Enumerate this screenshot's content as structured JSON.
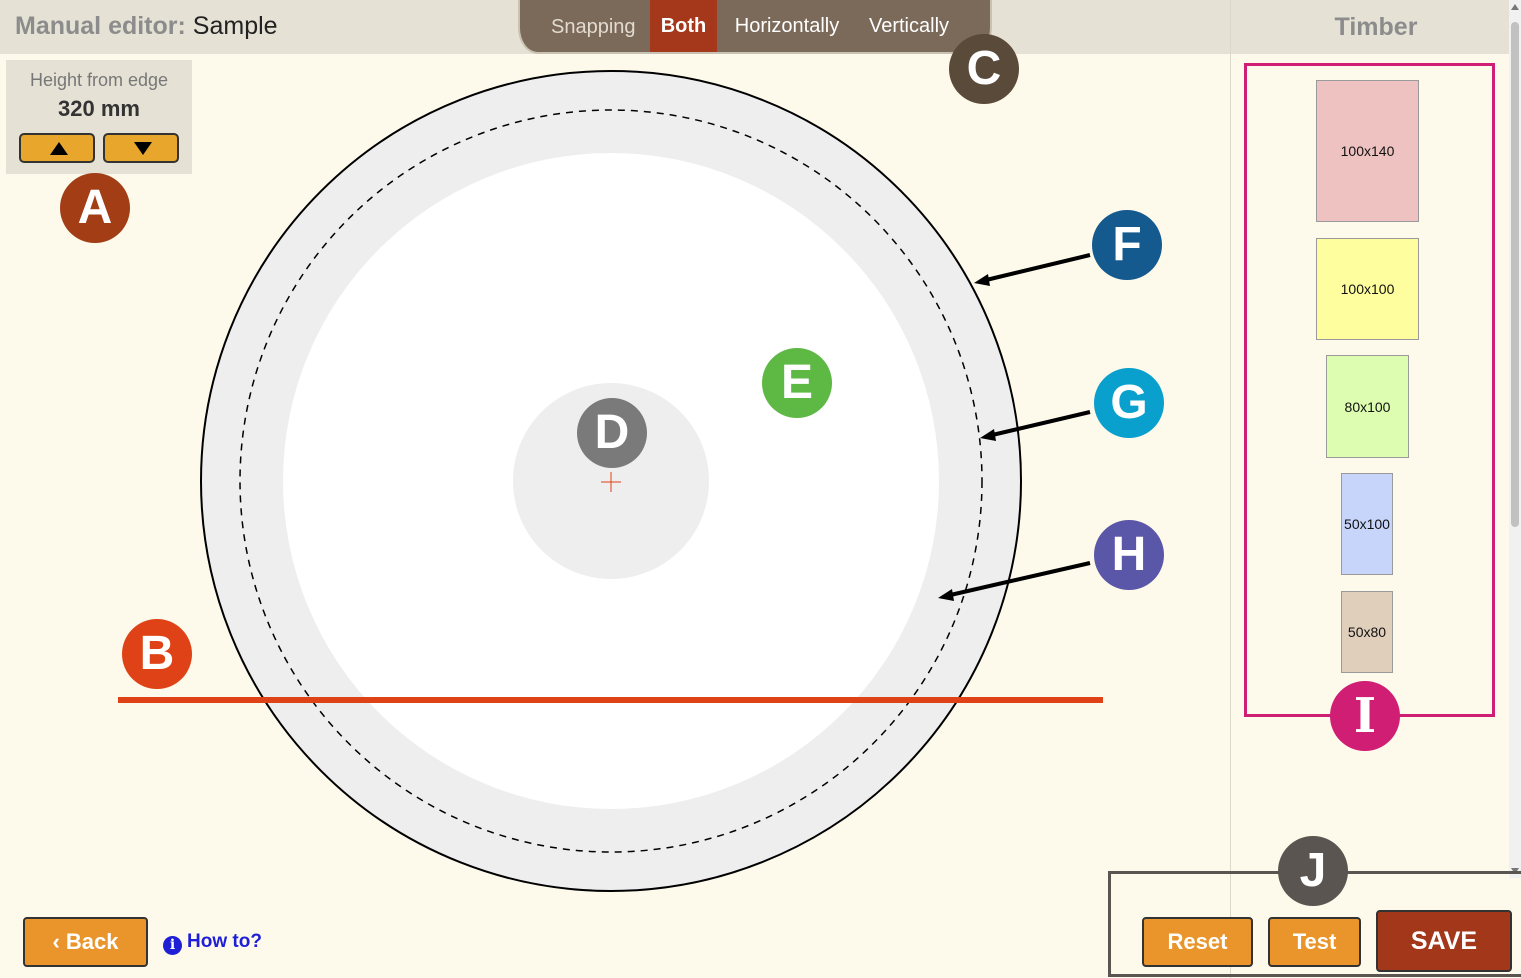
{
  "header": {
    "title_prefix": "Manual editor:",
    "title_name": "Sample"
  },
  "snapping": {
    "label": "Snapping",
    "options": [
      "Both",
      "Horizontally",
      "Vertically"
    ],
    "active": "Both",
    "active_color": "#a5371a"
  },
  "height_control": {
    "label": "Height from edge",
    "value": "320 mm",
    "up_icon": "triangle-up-icon",
    "down_icon": "triangle-down-icon"
  },
  "timber": {
    "title": "Timber",
    "items": [
      {
        "label": "100x140",
        "color": "#eec2c0"
      },
      {
        "label": "100x100",
        "color": "#fefe9e"
      },
      {
        "label": "80x100",
        "color": "#ddfeb0"
      },
      {
        "label": "50x100",
        "color": "#c8d5fb"
      },
      {
        "label": "50x80",
        "color": "#e0cfbb"
      }
    ],
    "highlight_color": "#d01e75"
  },
  "callouts": {
    "A": {
      "letter": "A",
      "color": "#a23d16"
    },
    "B": {
      "letter": "B",
      "color": "#de4216"
    },
    "C": {
      "letter": "C",
      "color": "#5a4a3a"
    },
    "D": {
      "letter": "D",
      "color": "#7a7a7a"
    },
    "E": {
      "letter": "E",
      "color": "#5db844"
    },
    "F": {
      "letter": "F",
      "color": "#145a8f"
    },
    "G": {
      "letter": "G",
      "color": "#0aa0ce"
    },
    "H": {
      "letter": "H",
      "color": "#5a56a8"
    },
    "I": {
      "letter": "I",
      "color": "#d01e75"
    },
    "J": {
      "letter": "J",
      "color": "#5a5550"
    }
  },
  "cut_line_color": "#de4216",
  "footer": {
    "back_label": "Back",
    "howto_label": "How to?",
    "reset_label": "Reset",
    "test_label": "Test",
    "save_label": "SAVE"
  }
}
